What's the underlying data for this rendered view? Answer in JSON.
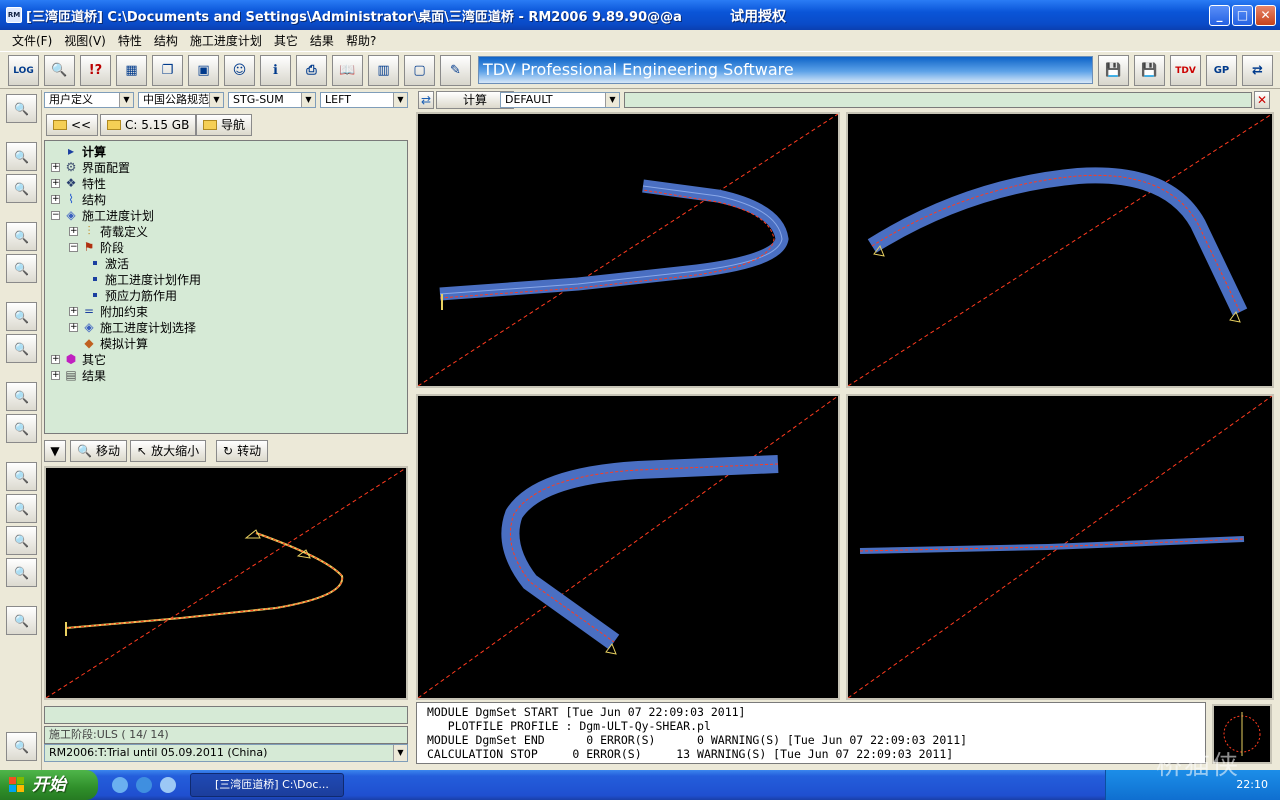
{
  "window": {
    "title": "[三湾匝道桥] C:\\Documents and Settings\\Administrator\\桌面\\三湾匝道桥 - RM2006 9.89.90@@a",
    "trial_label": "试用授权",
    "app_icon_label": "RM",
    "controls": {
      "minimize": "_",
      "maximize": "□",
      "close": "✕"
    }
  },
  "menu": [
    "文件(F)",
    "视图(V)",
    "特性",
    "结构",
    "施工进度计划",
    "其它",
    "结果",
    "帮助?"
  ],
  "toolbar": {
    "banner": "TDV Professional Engineering Software",
    "log_label": "LOG",
    "help_label": "!?",
    "tdv_label": "TDV",
    "gp_label": "GP"
  },
  "selectors": {
    "user_def": "用户定义",
    "code": "中国公路规范",
    "stage": "STG-SUM",
    "side": "LEFT",
    "calc_default": "DEFAULT"
  },
  "buttons": {
    "back": "<<",
    "drive": "C: 5.15 GB",
    "nav": "导航",
    "calc": "计算",
    "move": "移动",
    "zoom": "放大缩小",
    "rotate": "转动"
  },
  "tree": [
    {
      "label": "计算",
      "level": 0,
      "bold": true
    },
    {
      "label": "界面配置",
      "level": 0
    },
    {
      "label": "特性",
      "level": 0
    },
    {
      "label": "结构",
      "level": 0
    },
    {
      "label": "施工进度计划",
      "level": 0
    },
    {
      "label": "荷载定义",
      "level": 1
    },
    {
      "label": "阶段",
      "level": 1
    },
    {
      "label": "激活",
      "level": 2
    },
    {
      "label": "施工进度计划作用",
      "level": 2
    },
    {
      "label": "预应力筋作用",
      "level": 2
    },
    {
      "label": "附加约束",
      "level": 1
    },
    {
      "label": "施工进度计划选择",
      "level": 1
    },
    {
      "label": "模拟计算",
      "level": 1
    },
    {
      "label": "其它",
      "level": 0
    },
    {
      "label": "结果",
      "level": 0
    }
  ],
  "status": {
    "stage_info": "施工阶段:ULS   ( 14/ 14)",
    "license": "RM2006:T:Trial until 05.09.2011 (China)"
  },
  "log": [
    "MODULE DgmSet START [Tue Jun 07 22:09:03 2011]",
    "   PLOTFILE PROFILE : Dgm-ULT-Qy-SHEAR.pl",
    "MODULE DgmSet END      0 ERROR(S)      0 WARNING(S) [Tue Jun 07 22:09:03 2011]",
    "CALCULATION STOP     0 ERROR(S)     13 WARNING(S) [Tue Jun 07 22:09:03 2011]"
  ],
  "taskbar": {
    "start": "开始",
    "task": "[三湾匝道桥] C:\\Doc...",
    "clock": "22:10",
    "watermark": "桥猫侠"
  },
  "colors": {
    "deck": "#4a6fc2",
    "axis": "#ff3b1f",
    "tree_bg": "#d6ead6",
    "title_bar": "#0a55d8"
  }
}
